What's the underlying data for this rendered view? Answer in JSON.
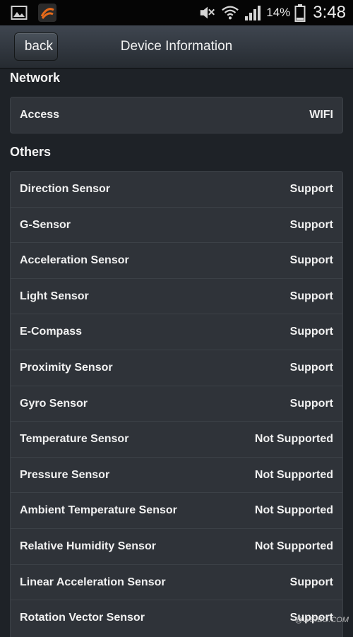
{
  "status_bar": {
    "left_icons": [
      "image-icon",
      "app-icon"
    ],
    "right_icons": [
      "mute-icon",
      "wifi-icon",
      "signal-icon",
      "battery-icon"
    ],
    "battery_percent": "14%",
    "time": "3:48",
    "app_icon_color": "#e86a1a"
  },
  "header": {
    "back_label": "back",
    "title": "Device Information"
  },
  "network": {
    "heading": "Network",
    "rows": [
      {
        "label": "Access",
        "value": "WIFI"
      }
    ]
  },
  "others": {
    "heading": "Others",
    "rows": [
      {
        "label": "Direction Sensor",
        "value": "Support"
      },
      {
        "label": "G-Sensor",
        "value": "Support"
      },
      {
        "label": "Acceleration Sensor",
        "value": "Support"
      },
      {
        "label": "Light Sensor",
        "value": "Support"
      },
      {
        "label": "E-Compass",
        "value": "Support"
      },
      {
        "label": "Proximity Sensor",
        "value": "Support"
      },
      {
        "label": "Gyro Sensor",
        "value": "Support"
      },
      {
        "label": "Temperature Sensor",
        "value": "Not Supported"
      },
      {
        "label": "Pressure Sensor",
        "value": "Not Supported"
      },
      {
        "label": "Ambient Temperature Sensor",
        "value": "Not Supported"
      },
      {
        "label": "Relative Humidity Sensor",
        "value": "Not Supported"
      },
      {
        "label": "Linear Acceleration Sensor",
        "value": "Support"
      },
      {
        "label": "Rotation Vector Sensor",
        "value": "Support"
      }
    ]
  },
  "watermark": "@WEIBO.COM"
}
